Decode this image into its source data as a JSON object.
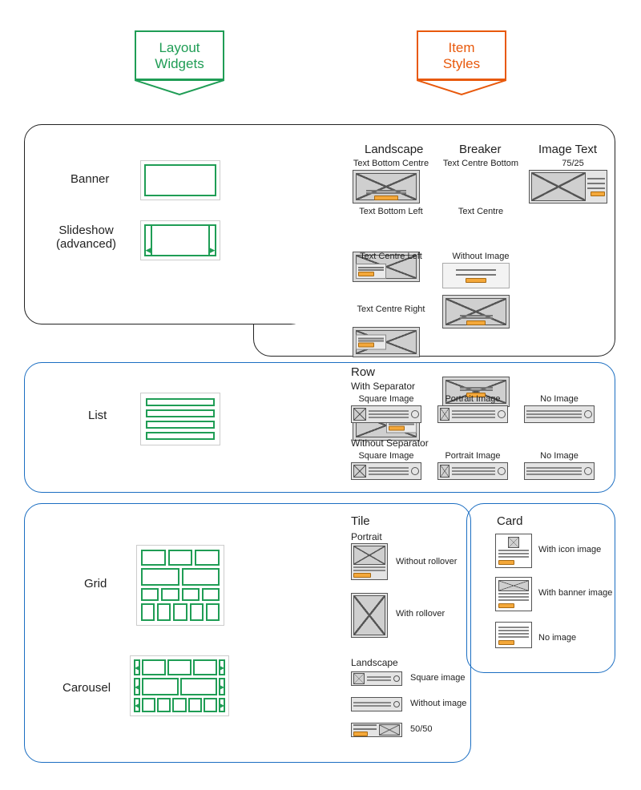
{
  "headers": {
    "layout_widgets": "Layout\nWidgets",
    "item_styles": "Item\nStyles"
  },
  "widgets": {
    "banner": "Banner",
    "slideshow": "Slideshow\n(advanced)",
    "list": "List",
    "grid": "Grid",
    "carousel": "Carousel"
  },
  "top_columns": {
    "landscape": "Landscape",
    "breaker": "Breaker",
    "image_text": "Image Text"
  },
  "landscape_variants": {
    "v1": "Text Bottom Centre",
    "v2": "Text Bottom Left",
    "v3": "Text Centre Left",
    "v4": "Text Centre Right"
  },
  "breaker_variants": {
    "v1": "Text Centre Bottom",
    "v2": "Text Centre",
    "v3": "Without Image"
  },
  "image_text_variants": {
    "v1": "75/25"
  },
  "row_section": {
    "title": "Row",
    "with_sep": "With Separator",
    "without_sep": "Without Separator",
    "square": "Square Image",
    "portrait": "Portrait Image",
    "none": "No Image"
  },
  "tile_section": {
    "title": "Tile",
    "portrait": "Portrait",
    "landscape": "Landscape",
    "without_rollover": "Without rollover",
    "with_rollover": "With rollover",
    "square_image": "Square image",
    "without_image": "Without image",
    "fifty": "50/50"
  },
  "card_section": {
    "title": "Card",
    "with_icon": "With icon image",
    "with_banner": "With banner image",
    "no_image": "No image"
  }
}
